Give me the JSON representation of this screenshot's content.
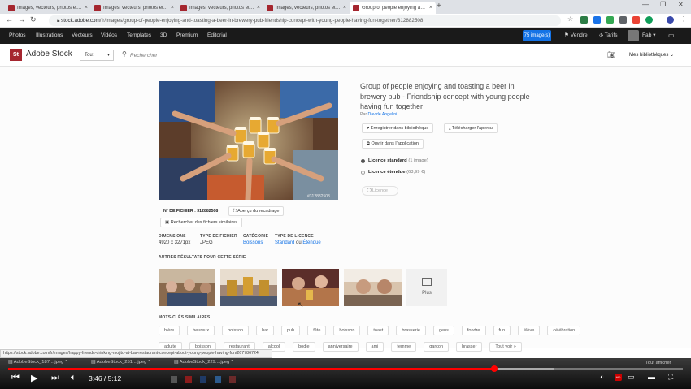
{
  "browser": {
    "tabs": [
      {
        "label": "Images, vecteurs, photos et vidé...",
        "active": false
      },
      {
        "label": "Images, vecteurs, photos et vidé...",
        "active": false
      },
      {
        "label": "Images, vecteurs, photos et vidé...",
        "active": false
      },
      {
        "label": "Images, vecteurs, photos et vidé...",
        "active": false
      },
      {
        "label": "Group of people enjoying and to...",
        "active": true
      }
    ],
    "url_host": "stock.adobe.com",
    "url_path": "/fr/images/group-of-people-enjoying-and-toasting-a-beer-in-brewery-pub-friendship-concept-with-young-people-having-fun-together/312882508"
  },
  "sitenav": {
    "items": [
      "Photos",
      "Illustrations",
      "Vecteurs",
      "Vidéos",
      "Templates",
      "3D",
      "Premium",
      "Éditorial"
    ],
    "images_badge": "75 image(s)",
    "sell": "Vendre",
    "pricing": "Tarifs",
    "user": "Fab"
  },
  "search": {
    "brand": "Adobe Stock",
    "logo_text": "St",
    "filter": "Tout",
    "placeholder": "Rechercher",
    "libraries": "Mes bibliothèques"
  },
  "asset": {
    "title": "Group of people enjoying and toasting a beer in brewery pub - Friendship concept with young people having fun together",
    "author_prefix": "Par",
    "author": "Davide Angelini",
    "photo_id": "#312882508",
    "save_library": "Enregistrer dans bibliothèque",
    "download_preview": "Télécharger l'aperçu",
    "open_in_app": "Ouvrir dans l'application",
    "license_standard": "Licence standard",
    "license_standard_note": "(1 image)",
    "license_extended": "Licence étendue",
    "license_extended_note": "(63,99 €)",
    "license_button": "Licence",
    "file_no_label": "N° DE FICHIER :",
    "file_no": "312882508",
    "crop_preview": "Aperçu du recadrage",
    "find_similar": "Rechercher des fichiers similaires",
    "meta": {
      "dimensions_label": "DIMENSIONS",
      "dimensions": "4920 x 3271px",
      "type_label": "TYPE DE FICHIER",
      "type": "JPEG",
      "category_label": "CATÉGORIE",
      "category": "Boissons",
      "license_type_label": "TYPE DE LICENCE",
      "license_type_std": "Standard",
      "license_type_or": "ou",
      "license_type_ext": "Étendue"
    }
  },
  "series": {
    "heading": "AUTRES RÉSULTATS POUR CETTE SÉRIE",
    "more": "Plus"
  },
  "keywords": {
    "heading": "MOTS-CLÉS SIMILAIRES",
    "row1": [
      "bière",
      "heureux",
      "boisson",
      "bar",
      "pub",
      "fête",
      "boisson",
      "toast",
      "brasserie",
      "gens",
      "fondre",
      "fun",
      "élève",
      "célébration"
    ],
    "row2": [
      "adulte",
      "boisson",
      "restaurant",
      "alcool",
      "bodie",
      "anniversaire",
      "ami",
      "femme",
      "garçon",
      "brasser",
      "Tout voir »"
    ]
  },
  "statusbar": {
    "url": "https://stock.adobe.com/fr/images/happy-friends-drinking-mojito-at-bar-restaurant-concept-about-young-people-having-fun/267786724"
  },
  "downloads": {
    "items": [
      "AdobeStock_187....jpeg",
      "AdobeStock_251....jpeg",
      "AdobeStock_229....jpeg"
    ],
    "show_all": "Tout afficher"
  },
  "player": {
    "time": "3:46 / 5:12",
    "progress": 0.72,
    "buffered": 0.81
  }
}
